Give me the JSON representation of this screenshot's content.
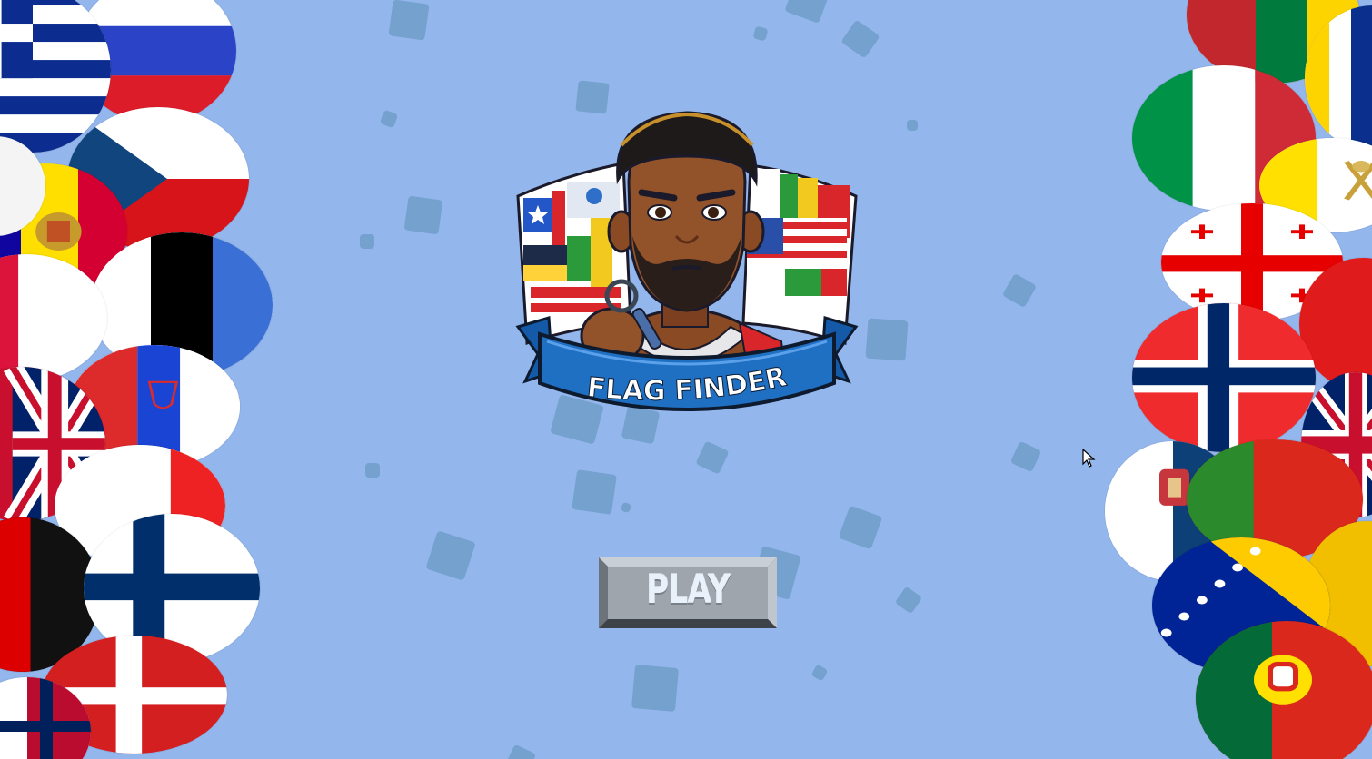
{
  "game": {
    "logo_title": "FLAG FINDER",
    "play_label": "PLAY"
  },
  "colors": {
    "background": "#93b6ec",
    "squares": "#6f9ec8",
    "ribbon": "#1f6fc2",
    "button_face": "#9ea5ad"
  },
  "icons": {
    "cursor": "mouse-pointer-icon"
  }
}
